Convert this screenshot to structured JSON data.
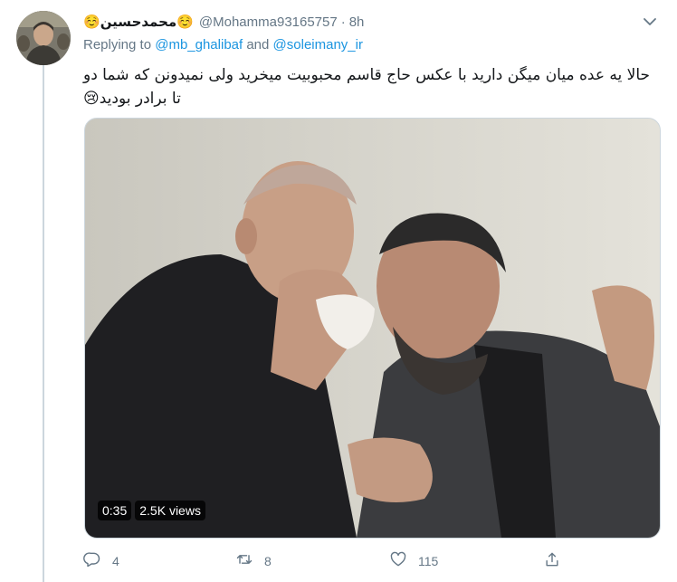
{
  "tweet": {
    "display_name": "☺️محمدحسین☺️",
    "handle": "@Mohamma93165757",
    "separator": "·",
    "time": "8h",
    "replying_prefix": "Replying to ",
    "reply_to_1": "@mb_ghalibaf",
    "reply_joiner": " and ",
    "reply_to_2": "@soleimany_ir",
    "text": "حالا یه عده میان میگن دارید با عکس حاج قاسم محبوبیت میخرید ولی نمیدونن که شما دو تا برادر بودید😢"
  },
  "video": {
    "duration": "0:35",
    "views": "2.5K views"
  },
  "actions": {
    "reply_count": "4",
    "retweet_count": "8",
    "like_count": "115",
    "share_count": ""
  },
  "icons": [
    "caret-down-icon",
    "reply-icon",
    "retweet-icon",
    "like-icon",
    "share-icon"
  ],
  "colors": {
    "link": "#1b95e0",
    "secondary": "#657786",
    "thread_line": "#ccd6dd"
  }
}
